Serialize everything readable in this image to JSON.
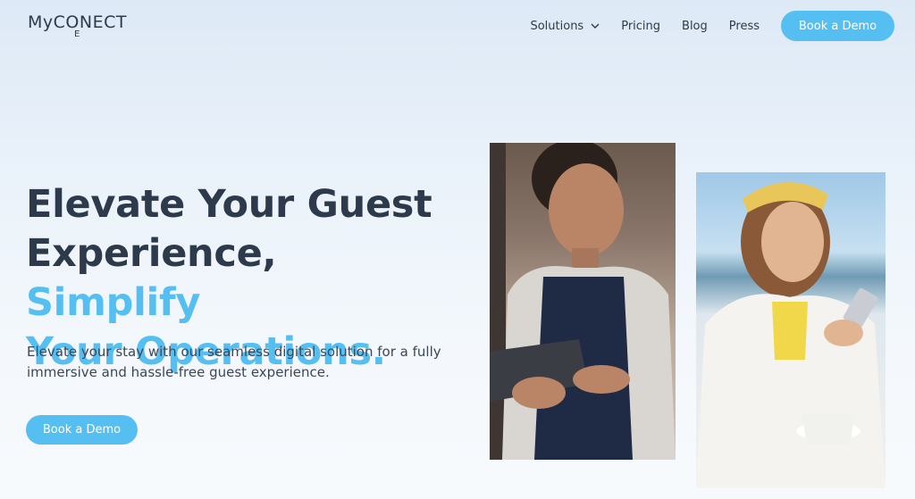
{
  "header": {
    "logo_main": "MyCONECT",
    "logo_sub": "E",
    "nav": [
      {
        "label": "Solutions",
        "has_dropdown": true
      },
      {
        "label": "Pricing"
      },
      {
        "label": "Blog"
      },
      {
        "label": "Press"
      }
    ],
    "cta_label": "Book a Demo"
  },
  "hero": {
    "title_line1": "Elevate Your Guest",
    "title_line2a": "Experience, ",
    "title_line2b": "Simplify",
    "title_line3": "Your Operations.",
    "subtitle": "Elevate your stay with our seamless digital solution for a fully immersive and hassle-free guest experience.",
    "cta_label": "Book a Demo"
  },
  "images": {
    "photo1": "waiter-holding-tablet-photo",
    "photo2": "woman-using-phone-photo"
  },
  "colors": {
    "accent": "#56bff2",
    "text": "#2d3a4b"
  }
}
